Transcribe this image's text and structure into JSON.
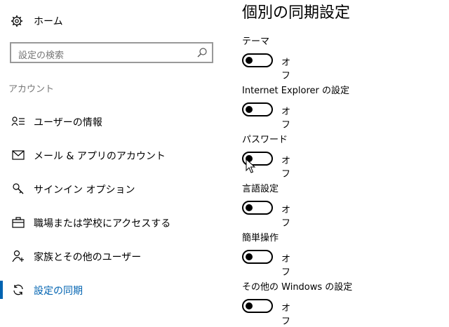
{
  "sidebar": {
    "home_label": "ホーム",
    "search_placeholder": "設定の検索",
    "section_heading": "アカウント",
    "items": [
      {
        "label": "ユーザーの情報",
        "icon": "user-info-icon"
      },
      {
        "label": "メール & アプリのアカウント",
        "icon": "mail-icon"
      },
      {
        "label": "サインイン オプション",
        "icon": "key-icon"
      },
      {
        "label": "職場または学校にアクセスする",
        "icon": "briefcase-icon"
      },
      {
        "label": "家族とその他のユーザー",
        "icon": "add-person-icon"
      },
      {
        "label": "設定の同期",
        "icon": "sync-icon",
        "active": true
      }
    ]
  },
  "main": {
    "title": "個別の同期設定",
    "settings": [
      {
        "name": "テーマ",
        "state": "オフ"
      },
      {
        "name": "Internet Explorer の設定",
        "state": "オフ"
      },
      {
        "name": "パスワード",
        "state": "オフ"
      },
      {
        "name": "言語設定",
        "state": "オフ"
      },
      {
        "name": "簡単操作",
        "state": "オフ"
      },
      {
        "name": "その他の Windows の設定",
        "state": "オフ"
      }
    ]
  },
  "colors": {
    "accent": "#0063b1",
    "muted_text": "#767676",
    "border": "#999999"
  }
}
